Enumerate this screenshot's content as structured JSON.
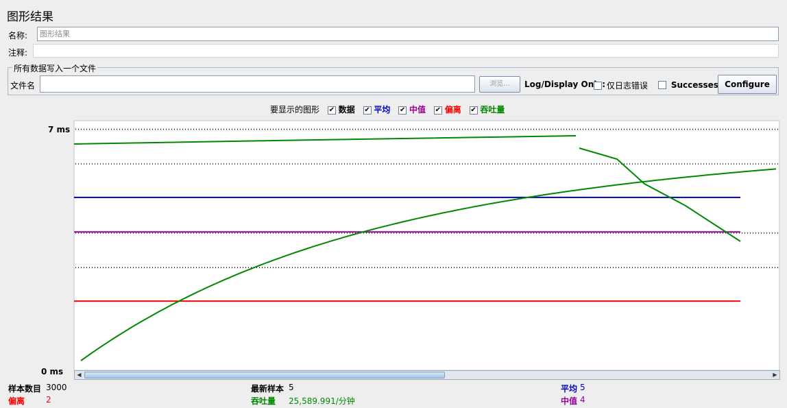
{
  "window": {
    "title": "图形结果"
  },
  "form": {
    "name_label": "名称:",
    "name_value": "图形结果",
    "comment_label": "注释:",
    "comment_value": ""
  },
  "file_section": {
    "legend": "所有数据写入一个文件",
    "file_label": "文件名",
    "file_value": "",
    "browse_label": "浏览...",
    "log_display_label": "Log/Display Only:",
    "errors_only_label": "仅日志错误",
    "errors_only_checked": false,
    "successes_label": "Successes",
    "successes_checked": false,
    "configure_label": "Configure"
  },
  "graph_options": {
    "title": "要显示的图形",
    "items": [
      {
        "label": "数据",
        "checked": true,
        "color": "#000000"
      },
      {
        "label": "平均",
        "checked": true,
        "color": "#0000cc"
      },
      {
        "label": "中值",
        "checked": true,
        "color": "#990099"
      },
      {
        "label": "偏离",
        "checked": true,
        "color": "#ff0000"
      },
      {
        "label": "吞吐量",
        "checked": true,
        "color": "#008800"
      }
    ]
  },
  "chart_data": {
    "type": "line",
    "ylabel_top": "7  ms",
    "ylabel_bottom": "0  ms",
    "ylim": [
      0,
      7
    ],
    "series": [
      {
        "name": "平均",
        "color": "#0000cc",
        "value": 5
      },
      {
        "name": "中值",
        "color": "#990099",
        "value": 4
      },
      {
        "name": "偏离",
        "color": "#ff0000",
        "value": 2
      },
      {
        "name": "吞吐量",
        "color": "#008800"
      }
    ]
  },
  "stats": {
    "samples_label": "样本数目",
    "samples_value": "3000",
    "latest_label": "最新样本",
    "latest_value": "5",
    "average_label": "平均",
    "average_value": "5",
    "deviation_label": "偏离",
    "deviation_value": "2",
    "throughput_label": "吞吐量",
    "throughput_value": "25,589.991/分钟",
    "median_label": "中值",
    "median_value": "4"
  }
}
